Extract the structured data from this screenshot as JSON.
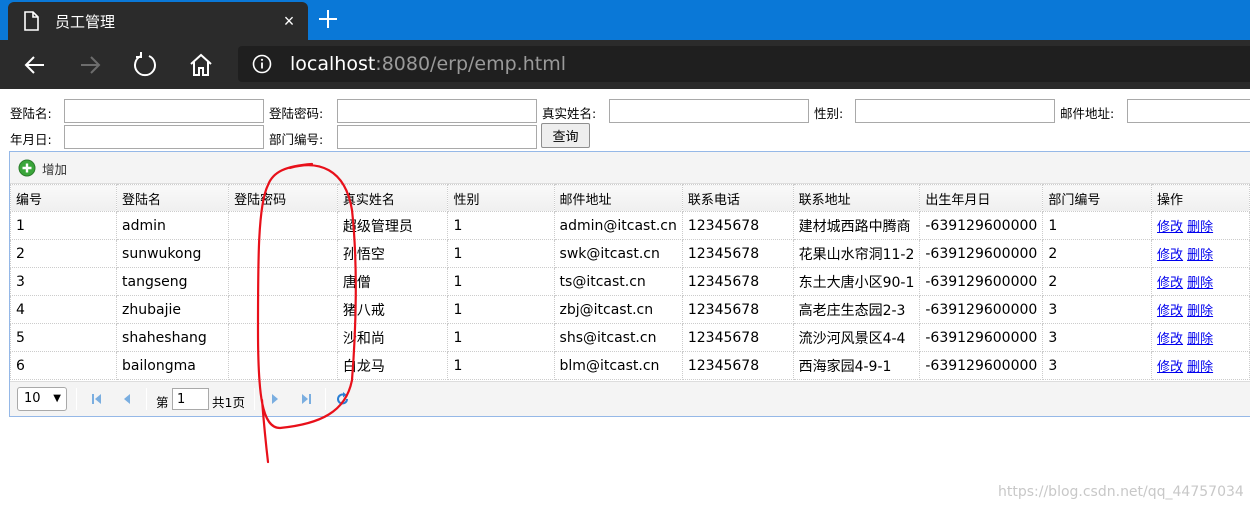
{
  "browser": {
    "tab_title": "员工管理",
    "tab_close": "×",
    "url_host": "localhost",
    "url_rest": ":8080/erp/emp.html"
  },
  "search": {
    "username_label": "登陆名:",
    "password_label": "登陆密码:",
    "realname_label": "真实姓名:",
    "gender_label": "性别:",
    "email_label": "邮件地址:",
    "birthday_label": "年月日:",
    "dept_label": "部门编号:",
    "query_button": "查询",
    "username_value": "",
    "password_value": "",
    "realname_value": "",
    "gender_value": "",
    "email_value": "",
    "birthday_value": "",
    "dept_value": ""
  },
  "toolbar": {
    "add_label": "增加"
  },
  "table": {
    "headers": [
      "编号",
      "登陆名",
      "登陆密码",
      "真实姓名",
      "性别",
      "邮件地址",
      "联系电话",
      "联系地址",
      "出生年月日",
      "部门编号",
      "操作"
    ],
    "rows": [
      [
        "1",
        "admin",
        "",
        "超级管理员",
        "1",
        "admin@itcast.cn",
        "12345678",
        "建材城西路中腾商",
        "-639129600000",
        "1"
      ],
      [
        "2",
        "sunwukong",
        "",
        "孙悟空",
        "1",
        "swk@itcast.cn",
        "12345678",
        "花果山水帘洞11-2",
        "-639129600000",
        "2"
      ],
      [
        "3",
        "tangseng",
        "",
        "唐僧",
        "1",
        "ts@itcast.cn",
        "12345678",
        "东土大唐小区90-1",
        "-639129600000",
        "2"
      ],
      [
        "4",
        "zhubajie",
        "",
        "猪八戒",
        "1",
        "zbj@itcast.cn",
        "12345678",
        "高老庄生态园2-3",
        "-639129600000",
        "3"
      ],
      [
        "5",
        "shaheshang",
        "",
        "沙和尚",
        "1",
        "shs@itcast.cn",
        "12345678",
        "流沙河风景区4-4",
        "-639129600000",
        "3"
      ],
      [
        "6",
        "bailongma",
        "",
        "白龙马",
        "1",
        "blm@itcast.cn",
        "12345678",
        "西海家园4-9-1",
        "-639129600000",
        "3"
      ]
    ],
    "edit_link": "修改",
    "delete_link": "删除"
  },
  "pager": {
    "page_size": "10",
    "page_prefix": "第",
    "page_value": "1",
    "page_total": "共1页"
  },
  "watermark": "https://blog.csdn.net/qq_44757034",
  "colors": {
    "tabbar": "#0a78d7",
    "chrome": "#2b2b2b",
    "grid_border": "#95b8e7",
    "link": "#0000ee",
    "annotation": "#e8101a"
  }
}
